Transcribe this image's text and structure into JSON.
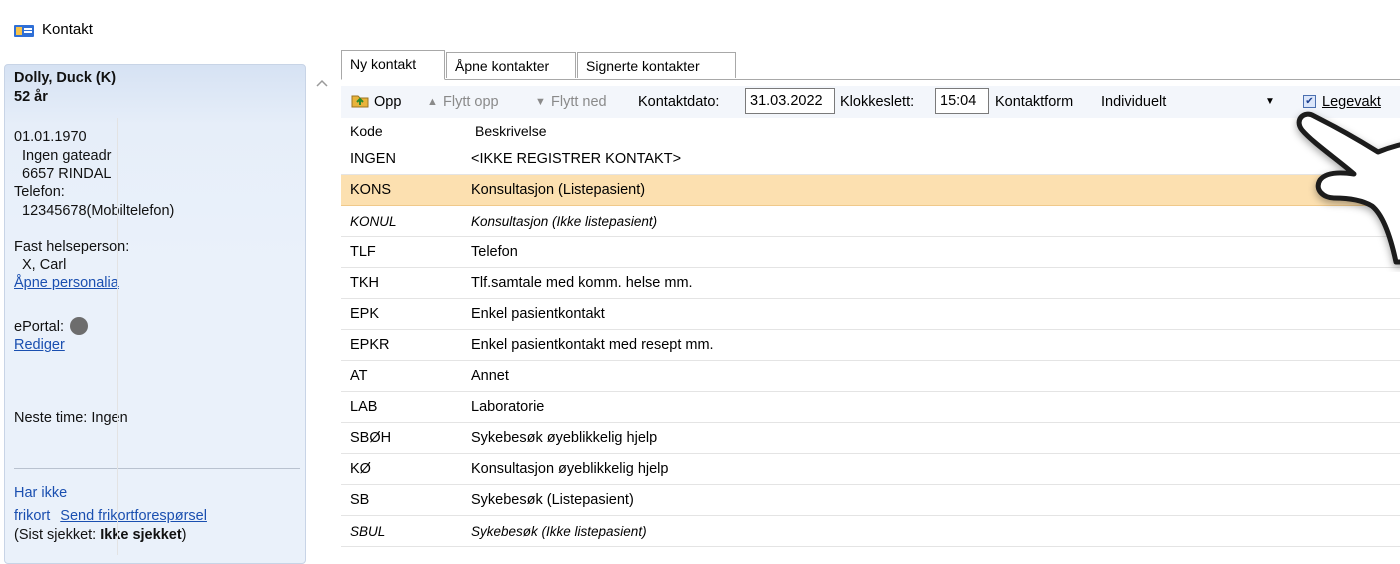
{
  "window": {
    "title": "Kontakt"
  },
  "patient": {
    "name": "Dolly, Duck (K)",
    "age": "52 år",
    "birthdate": "01.01.1970",
    "address_line1": "Ingen gateadr",
    "address_line2": "6657 RINDAL",
    "phone_label": "Telefon:",
    "phone": "12345678(Mobiltelefon)",
    "gp_label": "Fast helseperson:",
    "gp": "X, Carl",
    "open_personalia": "Åpne personalia",
    "eportal_label": "ePortal:",
    "edit": "Rediger",
    "next_appointment": "Neste time: Ingen",
    "frikort_status_1": "Har ikke",
    "frikort_status_2": "frikort",
    "send_frikort": "Send frikortforespørsel",
    "last_checked_prefix": "(Sist sjekket: ",
    "last_checked_value": "Ikke sjekket",
    "last_checked_suffix": ")"
  },
  "tabs": [
    {
      "label": "Ny kontakt",
      "active": true
    },
    {
      "label": "Åpne kontakter",
      "active": false
    },
    {
      "label": "Signerte kontakter",
      "active": false
    }
  ],
  "toolbar": {
    "up_label": "Opp",
    "move_up_label": "Flytt opp",
    "move_down_label": "Flytt ned",
    "date_label": "Kontaktdato:",
    "date_value": "31.03.2022",
    "time_label": "Klokkeslett:",
    "time_value": "15:04",
    "form_label": "Kontaktform",
    "form_value": "Individuelt",
    "emergency_label": "Legevakt",
    "emergency_checked": true
  },
  "table": {
    "headers": {
      "code": "Kode",
      "description": "Beskrivelse"
    },
    "rows": [
      {
        "code": "INGEN",
        "desc": "<IKKE REGISTRER KONTAKT>",
        "selected": false,
        "italic": false
      },
      {
        "code": "KONS",
        "desc": "Konsultasjon (Listepasient)",
        "selected": true,
        "italic": false
      },
      {
        "code": "KONUL",
        "desc": "Konsultasjon (Ikke listepasient)",
        "selected": false,
        "italic": true
      },
      {
        "code": "TLF",
        "desc": "Telefon",
        "selected": false,
        "italic": false
      },
      {
        "code": "TKH",
        "desc": "Tlf.samtale med komm. helse mm.",
        "selected": false,
        "italic": false
      },
      {
        "code": "EPK",
        "desc": "Enkel pasientkontakt",
        "selected": false,
        "italic": false
      },
      {
        "code": "EPKR",
        "desc": "Enkel pasientkontakt med resept mm.",
        "selected": false,
        "italic": false
      },
      {
        "code": "AT",
        "desc": "Annet",
        "selected": false,
        "italic": false
      },
      {
        "code": "LAB",
        "desc": "Laboratorie",
        "selected": false,
        "italic": false
      },
      {
        "code": "SBØH",
        "desc": "Sykebesøk øyeblikkelig hjelp",
        "selected": false,
        "italic": false
      },
      {
        "code": "KØ",
        "desc": "Konsultasjon øyeblikkelig hjelp",
        "selected": false,
        "italic": false
      },
      {
        "code": "SB",
        "desc": "Sykebesøk (Listepasient)",
        "selected": false,
        "italic": false
      },
      {
        "code": "SBUL",
        "desc": "Sykebesøk (Ikke listepasient)",
        "selected": false,
        "italic": true
      }
    ]
  },
  "colors": {
    "selected_row": "#fce0b0",
    "link": "#1a4fb0",
    "panel": "#e6eef9"
  }
}
